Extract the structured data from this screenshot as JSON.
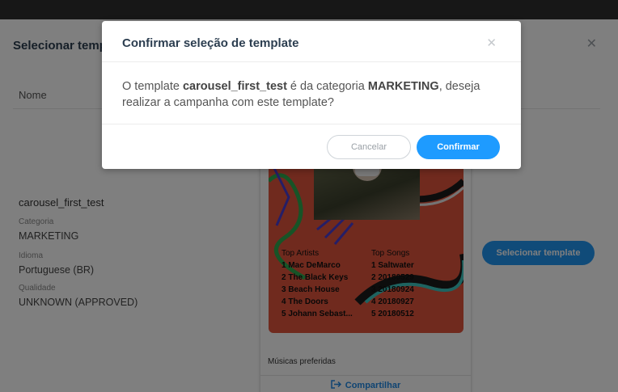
{
  "colors": {
    "accent": "#1e9bff",
    "overlay": "rgba(0,0,0,0.5)",
    "card_image_bg": "#e0543c"
  },
  "background_modal": {
    "title": "Selecionar template",
    "close_icon": "close-icon",
    "column_header": "Nome",
    "template": {
      "name": "carousel_first_test",
      "category_label": "Categoria",
      "category_value": "MARKETING",
      "language_label": "Idioma",
      "language_value": "Portuguese (BR)",
      "quality_label": "Qualidade",
      "quality_value": "UNKNOWN (APPROVED)"
    },
    "preview_card": {
      "top_artists_heading": "Top Artists",
      "top_songs_heading": "Top Songs",
      "top_artists": [
        "1  Mac DeMarco",
        "2  The Black Keys",
        "3  Beach House",
        "4  The Doors",
        "5  Johann Sebast..."
      ],
      "top_songs": [
        "1  Saltwater",
        "2  20180529",
        "3  20180924",
        "4  20180927",
        "5  20180512"
      ],
      "caption": "Músicas preferidas",
      "share_label": "Compartilhar",
      "share_icon": "share-icon"
    },
    "select_button": "Selecionar template"
  },
  "confirm_dialog": {
    "title": "Confirmar seleção de template",
    "close_icon": "close-icon",
    "body_prefix": "O template ",
    "body_template_name": "carousel_first_test",
    "body_middle": " é da categoria ",
    "body_category": "MARKETING",
    "body_suffix": ", deseja realizar a campanha com este template?",
    "cancel_label": "Cancelar",
    "confirm_label": "Confirmar"
  }
}
